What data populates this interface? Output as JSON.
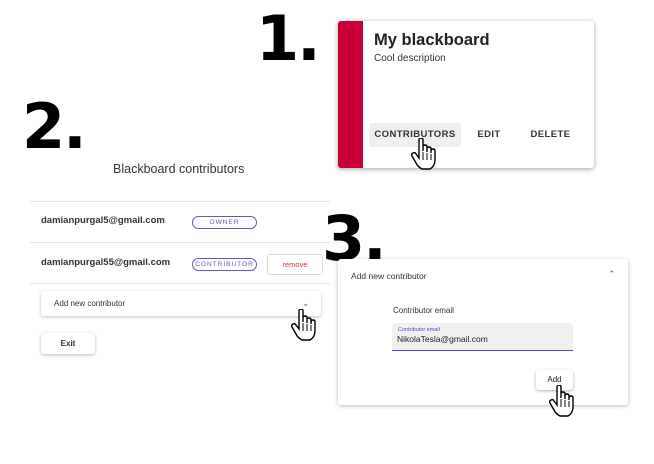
{
  "steps": [
    "1.",
    "2.",
    "3."
  ],
  "blackboard": {
    "title": "My blackboard",
    "description": "Cool description",
    "color": "#c8003a",
    "actions": {
      "contributors": "CONTRIBUTORS",
      "edit": "EDIT",
      "delete": "DELETE"
    }
  },
  "contributors_dialog": {
    "title": "Blackboard contributors",
    "rows": [
      {
        "email": "damianpurgal5@gmail.com",
        "role": "OWNER"
      },
      {
        "email": "damianpurgal55@gmail.com",
        "role": "CONTRIBUTOR",
        "remove_label": "remove"
      }
    ],
    "add_section_label": "Add new contributor",
    "exit_label": "Exit"
  },
  "add_contributor": {
    "header": "Add new contributor",
    "field_label": "Contributor email",
    "floating_label": "Contributor email",
    "field_value": "NikolaTesla@gmail.com",
    "add_label": "Add"
  },
  "colors": {
    "accent": "#5b3fc4",
    "remove": "#e0312c",
    "stripe": "#c8003a"
  },
  "icons": [
    "chevron-down-icon",
    "chevron-up-icon",
    "hand-pointer-icon"
  ]
}
